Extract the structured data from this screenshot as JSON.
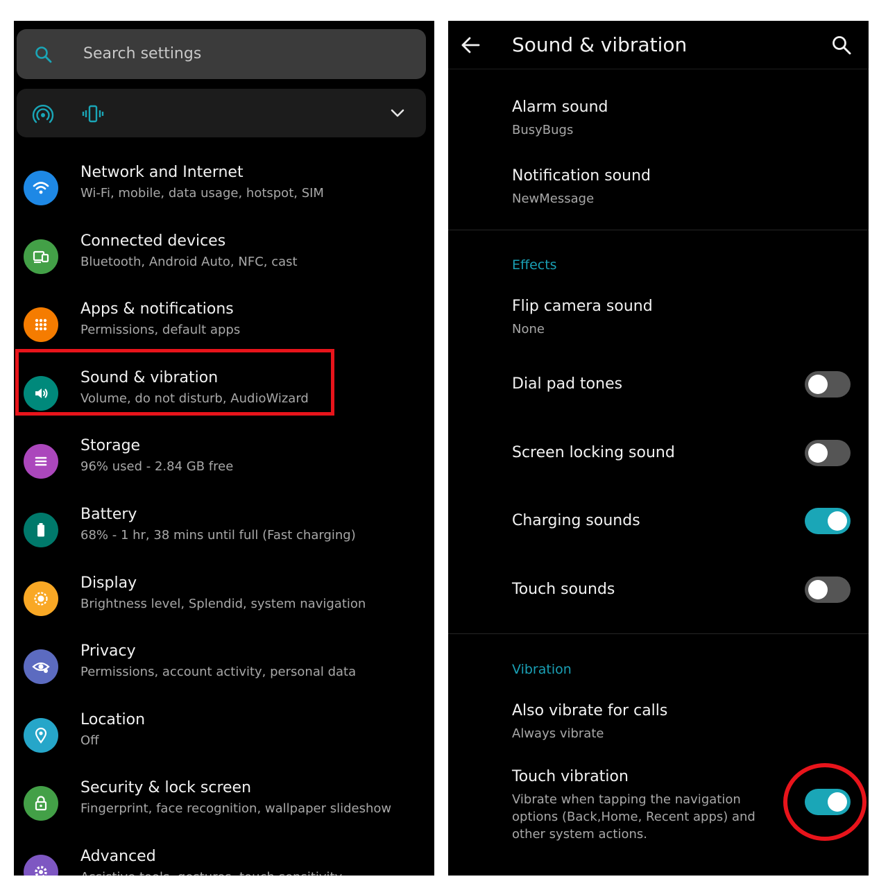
{
  "settings_list": {
    "search_placeholder": "Search settings",
    "quick_icons": [
      "hotspot-icon",
      "vibrate-icon",
      "chevron-down-icon"
    ],
    "items": [
      {
        "title": "Network and Internet",
        "subtitle": "Wi-Fi, mobile, data usage, hotspot, SIM",
        "icon": "wifi-icon",
        "color": "#1e88e5"
      },
      {
        "title": "Connected devices",
        "subtitle": "Bluetooth, Android Auto, NFC, cast",
        "icon": "devices-icon",
        "color": "#43a047"
      },
      {
        "title": "Apps & notifications",
        "subtitle": "Permissions, default apps",
        "icon": "apps-grid-icon",
        "color": "#f57c00"
      },
      {
        "title": "Sound & vibration",
        "subtitle": "Volume, do not disturb, AudioWizard",
        "icon": "speaker-icon",
        "color": "#00897b"
      },
      {
        "title": "Storage",
        "subtitle": "96% used - 2.84 GB free",
        "icon": "storage-icon",
        "color": "#ab47bc"
      },
      {
        "title": "Battery",
        "subtitle": "68% - 1 hr, 38 mins until full (Fast charging)",
        "icon": "battery-icon",
        "color": "#00796b"
      },
      {
        "title": "Display",
        "subtitle": "Brightness level, Splendid, system navigation",
        "icon": "brightness-icon",
        "color": "#f9a825"
      },
      {
        "title": "Privacy",
        "subtitle": "Permissions, account activity, personal data",
        "icon": "privacy-eye-icon",
        "color": "#5c6bc0"
      },
      {
        "title": "Location",
        "subtitle": "Off",
        "icon": "location-pin-icon",
        "color": "#26a6c9"
      },
      {
        "title": "Security & lock screen",
        "subtitle": "Fingerprint, face recognition, wallpaper slideshow",
        "icon": "lock-icon",
        "color": "#43a047"
      },
      {
        "title": "Advanced",
        "subtitle": "Assistive tools, gestures, touch sensitivity",
        "icon": "gear-icon",
        "color": "#7e57c2"
      }
    ],
    "highlighted": "Sound & vibration"
  },
  "sound_page": {
    "title": "Sound & vibration",
    "alarm": {
      "title": "Alarm sound",
      "value": "BusyBugs"
    },
    "notification": {
      "title": "Notification sound",
      "value": "NewMessage"
    },
    "effects_header": "Effects",
    "flip_camera": {
      "title": "Flip camera sound",
      "value": "None"
    },
    "toggles": [
      {
        "title": "Dial pad tones",
        "on": false
      },
      {
        "title": "Screen locking sound",
        "on": false
      },
      {
        "title": "Charging sounds",
        "on": true
      },
      {
        "title": "Touch sounds",
        "on": false
      }
    ],
    "vibration_header": "Vibration",
    "also_vibrate": {
      "title": "Also vibrate for calls",
      "value": "Always vibrate"
    },
    "touch_vibration": {
      "title": "Touch vibration",
      "description": "Vibrate when tapping the navigation options (Back,Home, Recent apps) and other system actions.",
      "on": true
    }
  },
  "colors": {
    "accent": "#1aa6b7",
    "highlight": "#e8141b",
    "section_header": "#1aa0b5"
  }
}
